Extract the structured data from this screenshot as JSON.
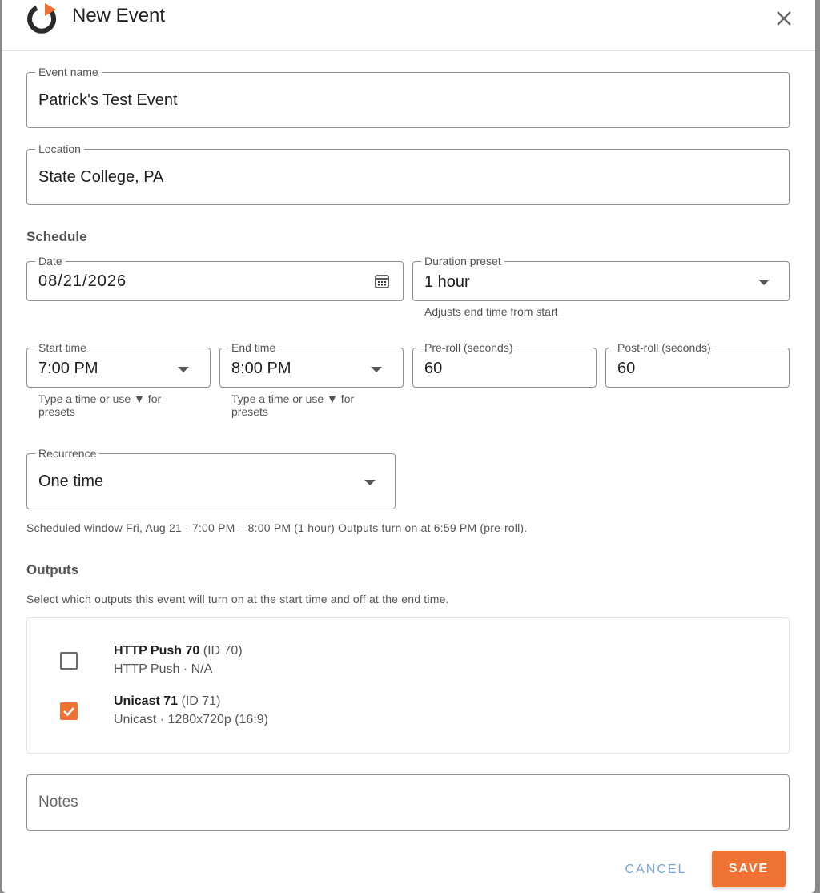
{
  "dialog": {
    "title": "New Event",
    "close_icon": "close-icon",
    "logo_icon": "power-play-logo"
  },
  "fields": {
    "event_name": {
      "label": "Event name",
      "value": "Patrick's Test Event"
    },
    "location": {
      "label": "Location",
      "value": "State College, PA"
    },
    "date": {
      "label": "Date",
      "value": "08/21/2026"
    },
    "duration": {
      "label": "Duration preset",
      "value": "1 hour",
      "helper": "Adjusts end time from start"
    },
    "start_time": {
      "label": "Start time",
      "value": "7:00 PM",
      "helper": "Type a time or use ▼ for presets"
    },
    "end_time": {
      "label": "End time",
      "value": "8:00 PM",
      "helper": "Type a time or use ▼ for presets"
    },
    "pre_roll": {
      "label": "Pre-roll (seconds)",
      "value": "60"
    },
    "post_roll": {
      "label": "Post-roll (seconds)",
      "value": "60"
    },
    "recurrence": {
      "label": "Recurrence",
      "value": "One time"
    },
    "notes": {
      "placeholder": "Notes"
    }
  },
  "schedule": {
    "heading": "Schedule",
    "summary": "Scheduled window Fri, Aug 21 · 7:00 PM – 8:00 PM (1 hour) Outputs turn on at 6:59 PM (pre-roll)."
  },
  "outputs": {
    "heading": "Outputs",
    "description": "Select which outputs this event will turn on at the start time and off at the end time.",
    "items": [
      {
        "name": "HTTP Push 70",
        "id": "(ID 70)",
        "detail": "HTTP Push · N/A",
        "checked": false
      },
      {
        "name": "Unicast 71",
        "id": "(ID 71)",
        "detail": "Unicast · 1280x720p (16:9)",
        "checked": true
      }
    ]
  },
  "actions": {
    "cancel": "CANCEL",
    "save": "SAVE"
  },
  "colors": {
    "accent": "#ee7234",
    "cancel_text": "#7ba7d8"
  }
}
